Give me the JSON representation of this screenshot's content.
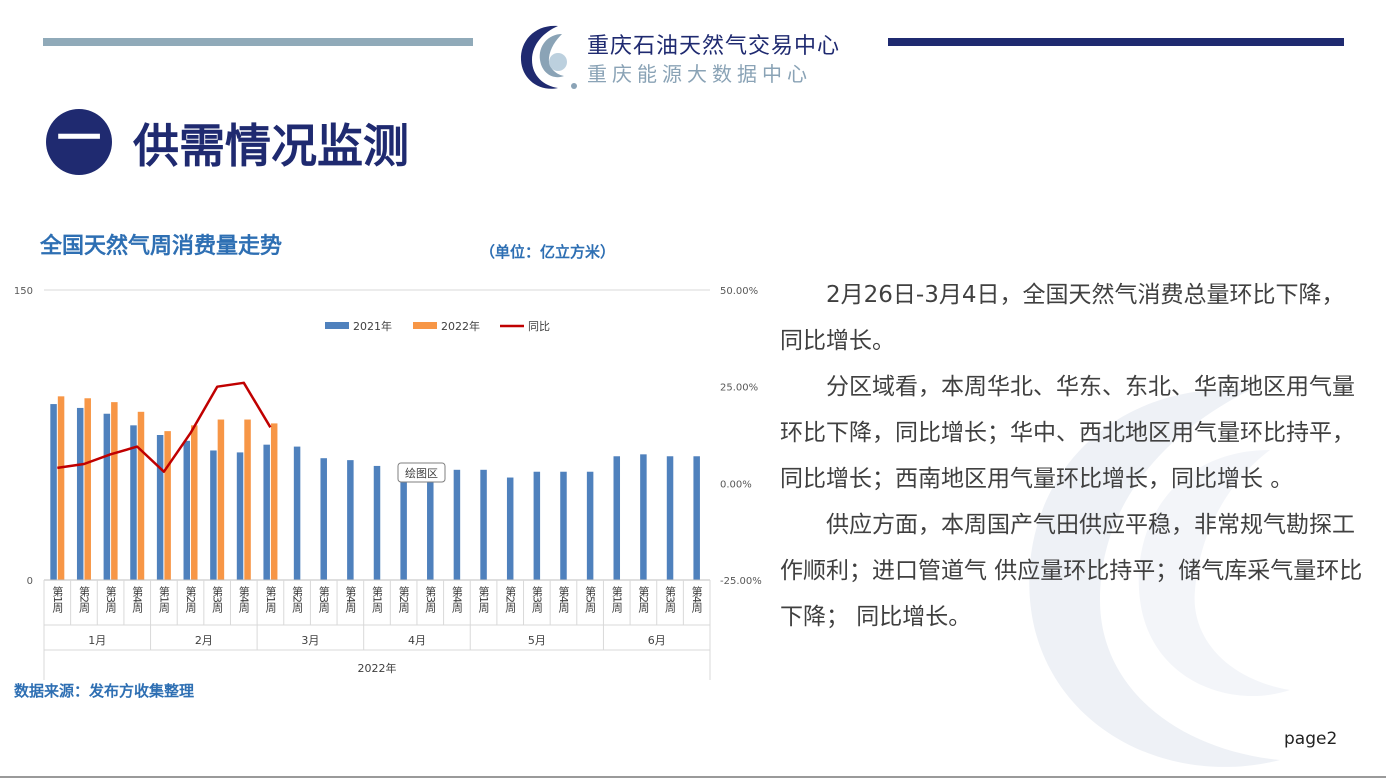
{
  "header": {
    "org_name": "重庆石油天然气交易中心",
    "org_sub": "重庆能源大数据中心"
  },
  "section": {
    "number": "一",
    "title": "供需情况监测"
  },
  "chart_title": "全国天然气周消费量走势",
  "unit": "（单位：亿立方米）",
  "source": "数据来源：发布方收集整理",
  "paragraphs": [
    "2月26日-3月4日，全国天然气消费总量环比下降，同比增长。",
    "分区域看，本周华北、华东、东北、华南地区用气量环比下降，同比增长；华中、西北地区用气量环比持平，同比增长；西南地区用气量环比增长，同比增长 。",
    "供应方面，本周国产气田供应平稳，非常规气勘探工作顺利；进口管道气 供应量环比持平；储气库采气量环比下降； 同比增长。"
  ],
  "page_label": "page2",
  "colors": {
    "navy": "#1f2a70",
    "accent_blue": "#2e6fb3",
    "series_2021": "#4f81bd",
    "series_2022": "#f79646",
    "series_yoy": "#c00000"
  },
  "chart_data": {
    "type": "bar",
    "left_axis": {
      "ylim": [
        0,
        150
      ],
      "ticks": [
        "150",
        "0"
      ]
    },
    "right_axis": {
      "ylim": [
        -25,
        50
      ],
      "ticks": [
        "50.00%",
        "25.00%",
        "0.00%",
        "-25.00%"
      ]
    },
    "legend": [
      "2021年",
      "2022年",
      "同比"
    ],
    "legend_position": "top",
    "tooltip": "绘图区",
    "year_label": "2022年",
    "categories": [
      "第1周",
      "第2周",
      "第3周",
      "第4周",
      "第1周",
      "第2周",
      "第3周",
      "第4周",
      "第1周",
      "第2周",
      "第3周",
      "第4周",
      "第1周",
      "第2周",
      "第3周",
      "第4周",
      "第1周",
      "第2周",
      "第3周",
      "第4周",
      "第5周",
      "第1周",
      "第2周",
      "第3周",
      "第4周"
    ],
    "months": [
      {
        "label": "1月",
        "count": 4
      },
      {
        "label": "2月",
        "count": 4
      },
      {
        "label": "3月",
        "count": 4
      },
      {
        "label": "4月",
        "count": 4
      },
      {
        "label": "5月",
        "count": 5
      },
      {
        "label": "6月",
        "count": 4
      }
    ],
    "series": [
      {
        "name": "2021年",
        "kind": "bar",
        "axis": "left",
        "values": [
          91,
          89,
          86,
          80,
          75,
          72,
          67,
          66,
          70,
          69,
          63,
          62,
          59,
          58,
          57,
          57,
          57,
          53,
          56,
          56,
          56,
          64,
          65,
          64,
          64
        ]
      },
      {
        "name": "2022年",
        "kind": "bar",
        "axis": "left",
        "values": [
          95,
          94,
          92,
          87,
          77,
          80,
          83,
          83,
          81,
          null,
          null,
          null,
          null,
          null,
          null,
          null,
          null,
          null,
          null,
          null,
          null,
          null,
          null,
          null,
          null
        ]
      },
      {
        "name": "同比",
        "kind": "line",
        "axis": "right",
        "values": [
          4.0,
          5.0,
          7.5,
          9.5,
          3.0,
          13.0,
          25.0,
          26.0,
          14.5,
          null,
          null,
          null,
          null,
          null,
          null,
          null,
          null,
          null,
          null,
          null,
          null,
          null,
          null,
          null,
          null
        ]
      }
    ]
  }
}
